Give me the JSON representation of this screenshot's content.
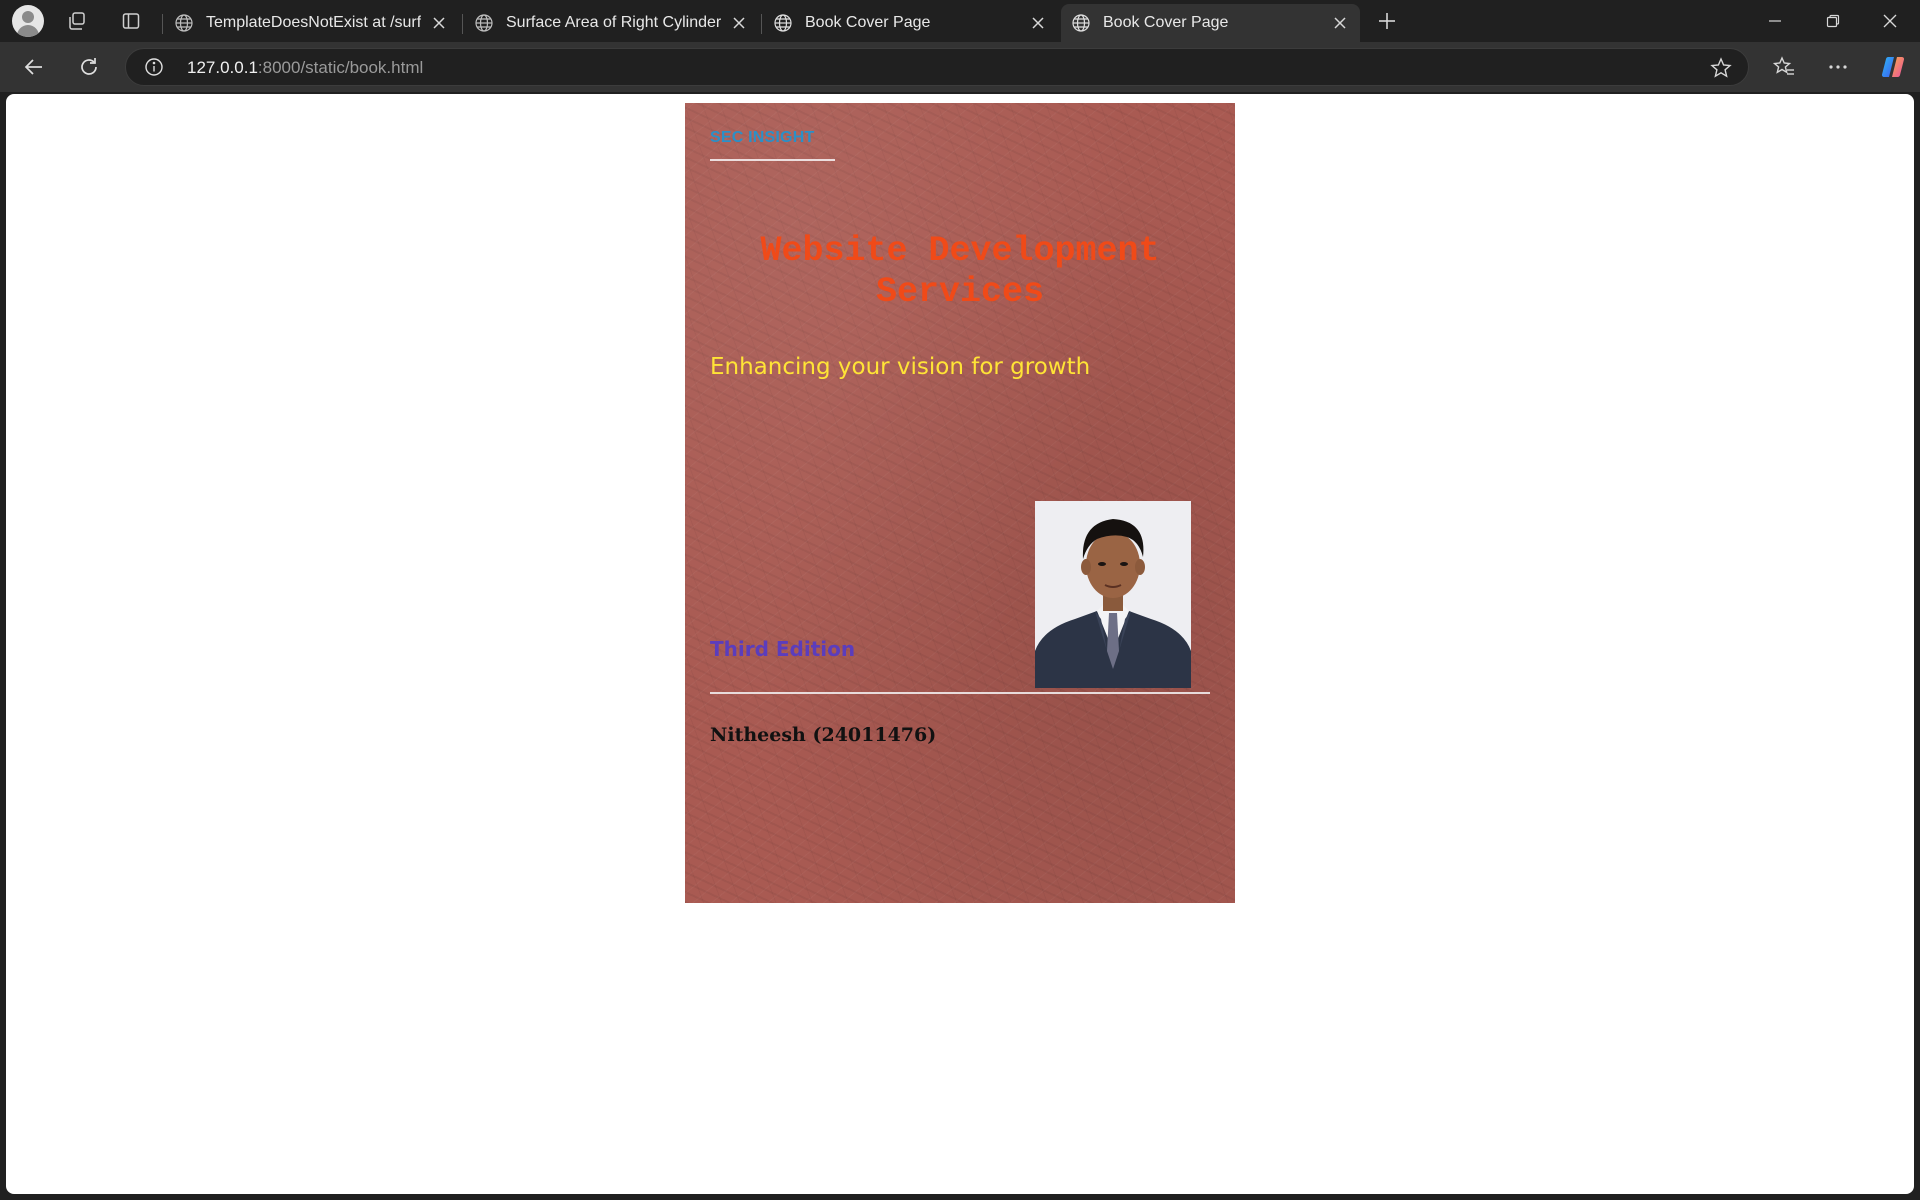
{
  "browser": {
    "tabs": [
      {
        "label": "TemplateDoesNotExist at /surface",
        "active": false
      },
      {
        "label": "Surface Area of Right Cylinder",
        "active": false
      },
      {
        "label": "Book Cover Page",
        "active": false
      },
      {
        "label": "Book Cover Page",
        "active": true
      }
    ],
    "address": {
      "host": "127.0.0.1",
      "path": ":8000/static/book.html"
    }
  },
  "cover": {
    "publisher": "SEC INSIGHT",
    "title": "Website Development Services",
    "subtitle": "Enhancing your vision for growth",
    "edition": "Third Edition",
    "author": "Nitheesh (24011476)",
    "colors": {
      "background": "#a95a52",
      "publisher": "#2a90c8",
      "title": "#f04a18",
      "subtitle": "#ffe436",
      "edition": "#5b3dbc",
      "author": "#111111"
    }
  },
  "icons": {
    "profile": "profile-avatar-icon",
    "workspaces": "workspaces-icon",
    "tab-actions": "vertical-tabs-icon",
    "site": "globe-icon",
    "close": "close-icon",
    "new-tab": "plus-icon",
    "back": "back-arrow-icon",
    "reload": "reload-icon",
    "info": "info-icon",
    "favorite": "star-icon",
    "favorites": "favorites-icon",
    "menu": "more-icon",
    "copilot": "copilot-icon"
  }
}
